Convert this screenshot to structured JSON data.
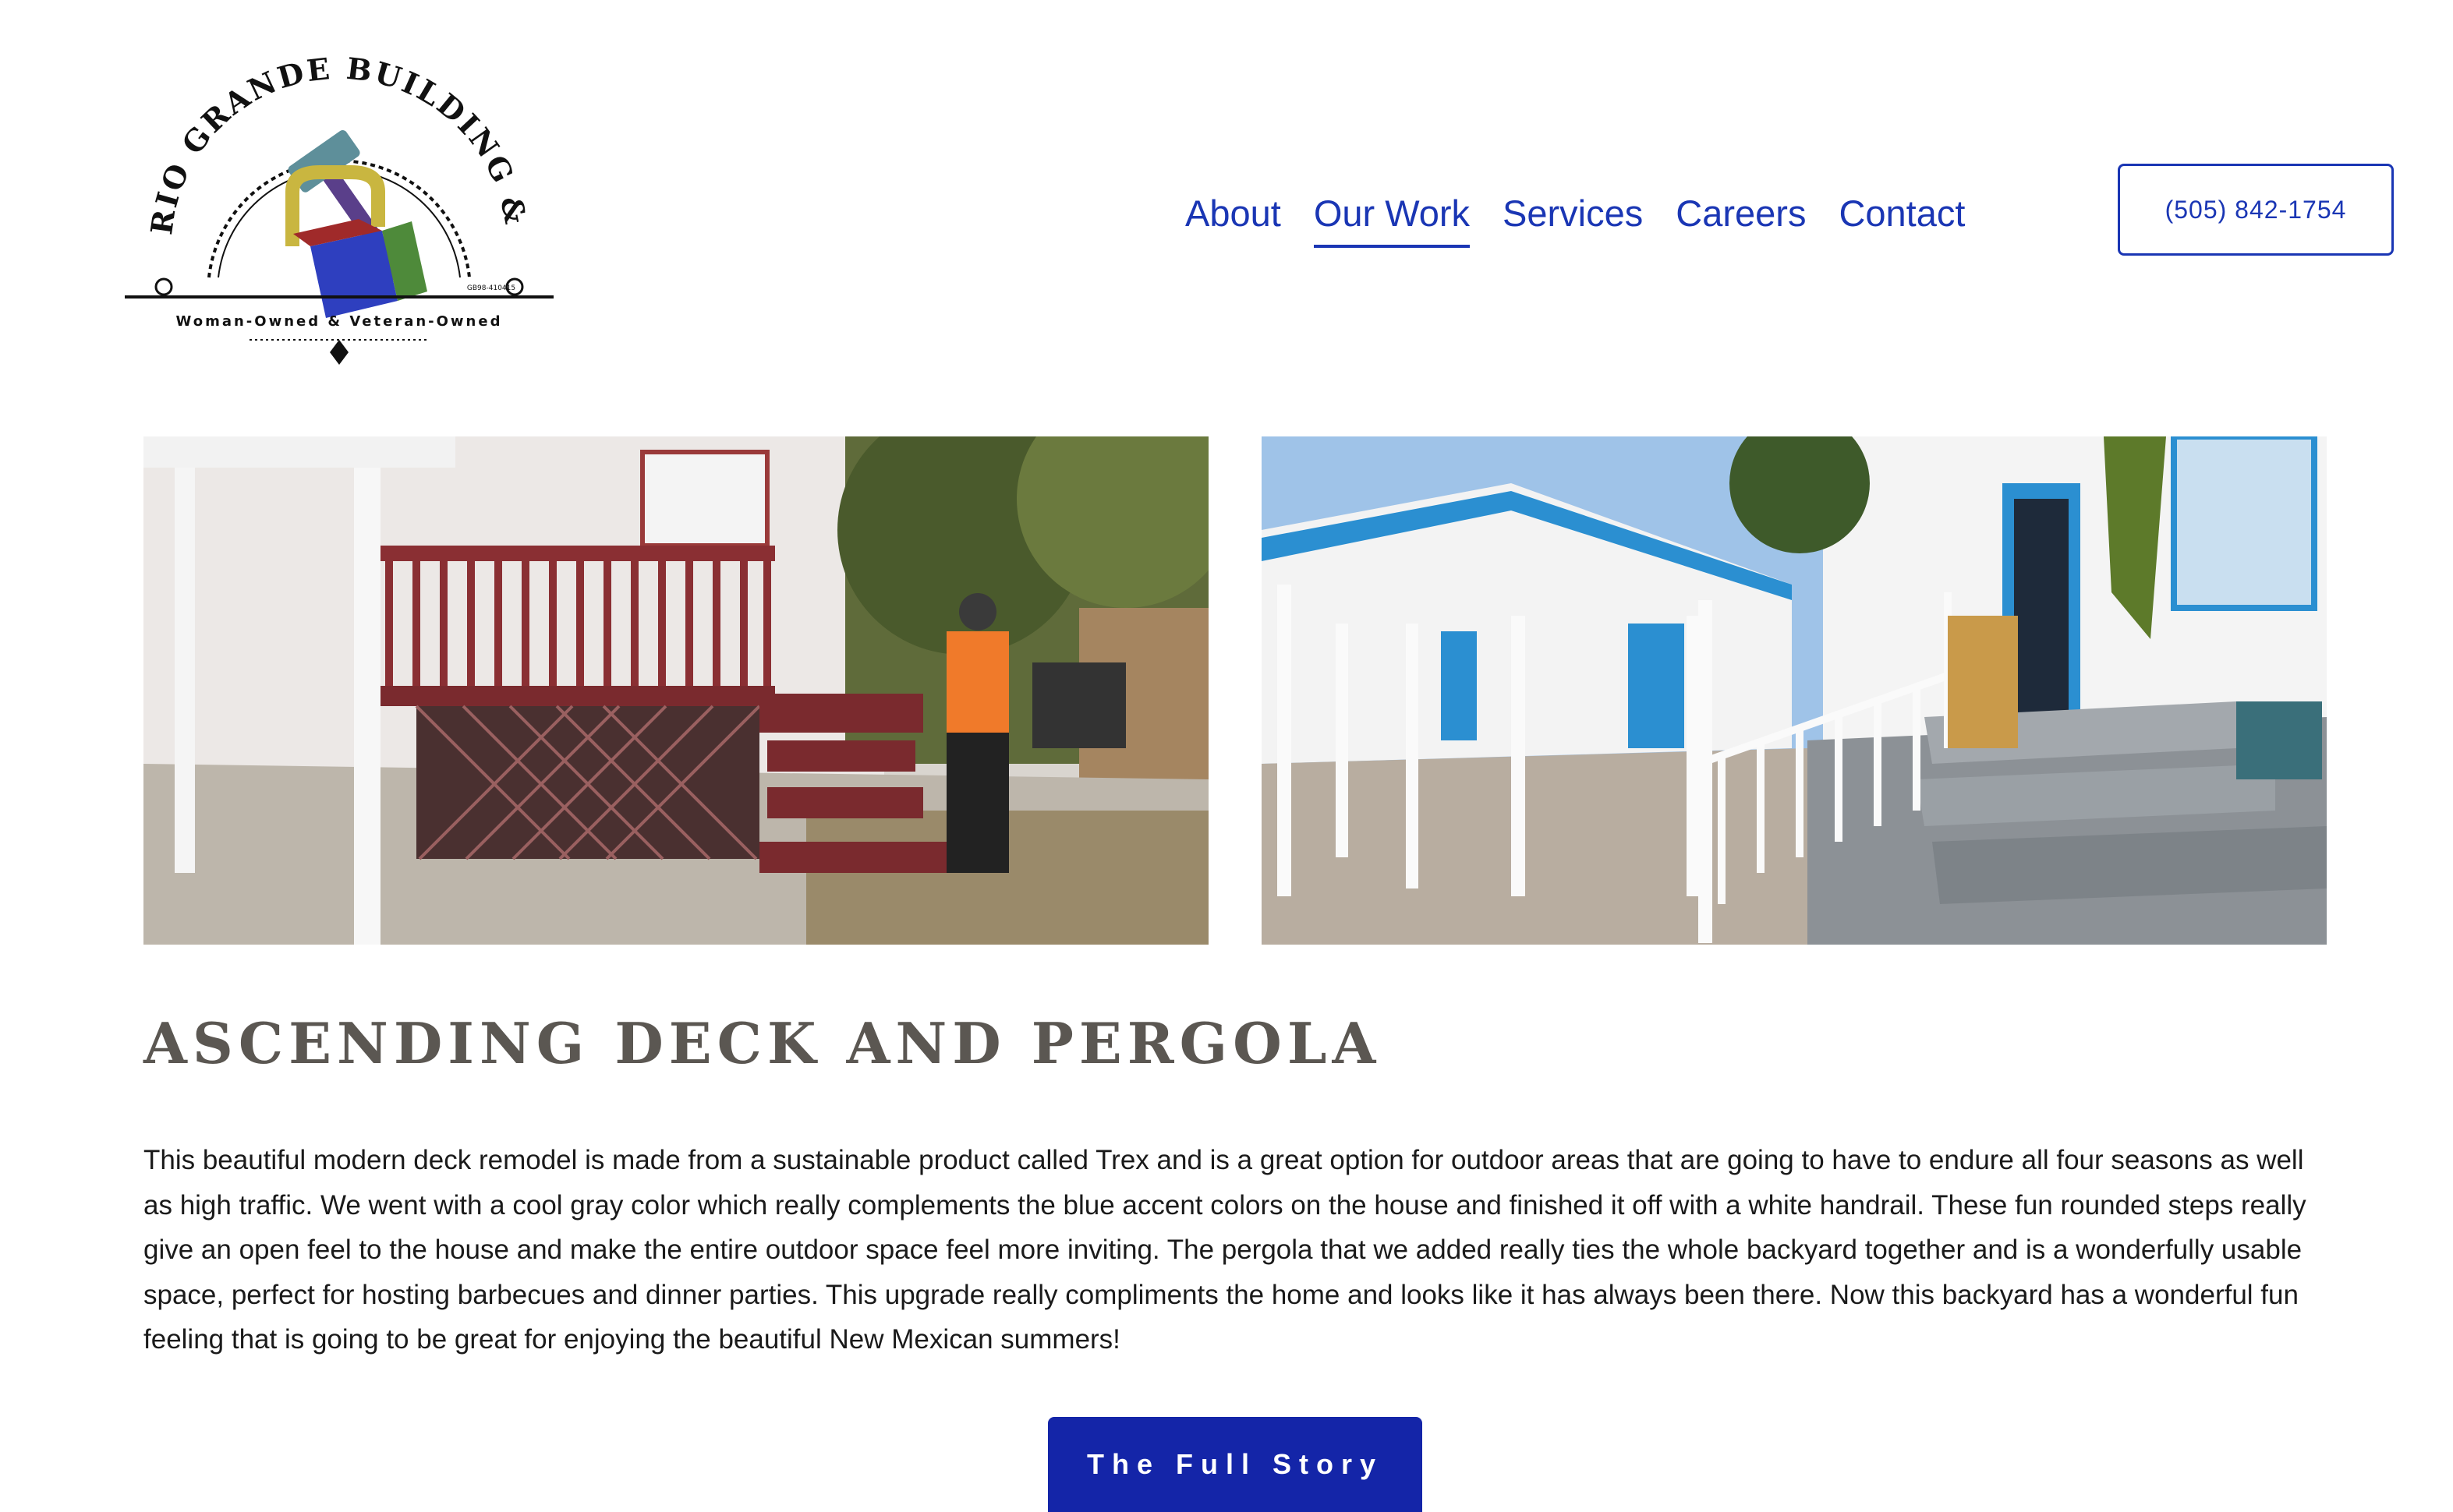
{
  "brand": {
    "logo_arc_text": "RIO GRANDE BUILDING & STORAGE",
    "logo_tagline": "Woman-Owned & Veteran-Owned",
    "logo_license": "GB98-410415"
  },
  "nav": {
    "items": [
      {
        "label": "About"
      },
      {
        "label": "Our Work",
        "active": true
      },
      {
        "label": "Services"
      },
      {
        "label": "Careers"
      },
      {
        "label": "Contact"
      }
    ],
    "phone": "(505) 842-1754"
  },
  "project": {
    "title": "ASCENDING DECK AND PERGOLA",
    "description": "This beautiful modern deck remodel is made from a sustainable product called Trex and is a great option for outdoor areas that are going to have to endure all four seasons as well as high traffic. We went with a cool gray color which really complements the blue accent colors on the house and finished it off with a white handrail. These fun rounded steps really give an open feel to the house and make the entire outdoor space feel more inviting. The pergola that we added really ties the whole backyard together and is a wonderfully usable space, perfect for hosting barbecues and dinner parties. This upgrade really compliments the home and looks like it has always been there. Now this backyard has a wonderful fun feeling that is going to be great for enjoying the beautiful New Mexican summers!",
    "cta": "The Full Story"
  },
  "colors": {
    "nav_blue": "#1a36b4",
    "button_blue": "#1425a8",
    "title_gray": "#5b5752"
  }
}
